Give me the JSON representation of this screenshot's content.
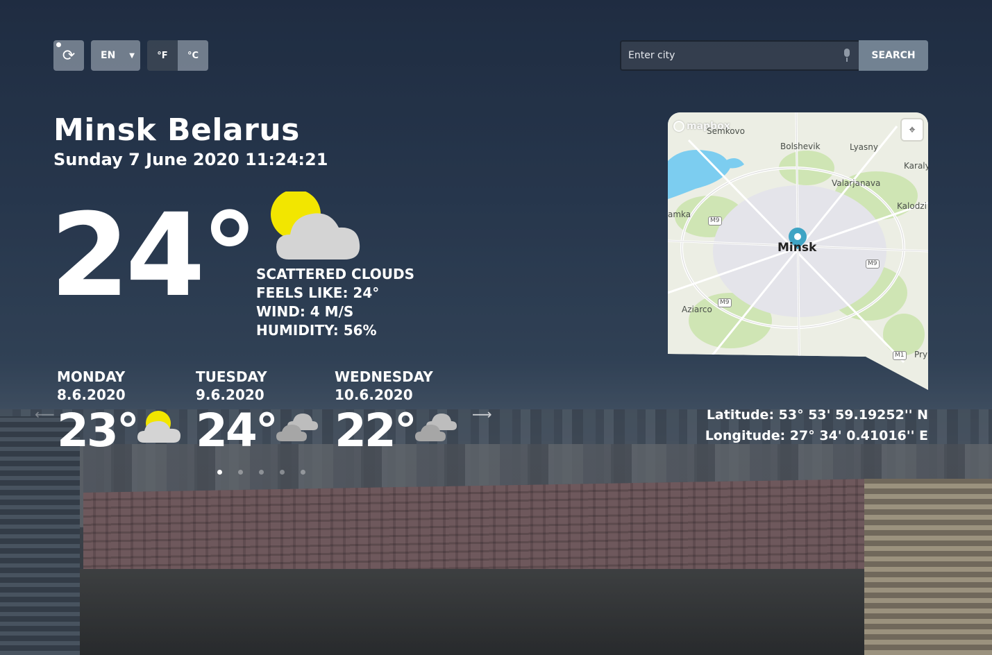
{
  "controls": {
    "refresh_icon": "refresh-icon",
    "language": "EN",
    "unit_f": "°F",
    "unit_c": "°C"
  },
  "search": {
    "placeholder": "Enter city",
    "button_label": "SEARCH",
    "mic_icon": "microphone-icon"
  },
  "location": {
    "city": "Minsk Belarus",
    "datetime": "Sunday 7 June 2020 11:24:21"
  },
  "current": {
    "temperature": "24°",
    "icon": "sun-behind-cloud-icon",
    "description": "SCATTERED CLOUDS",
    "feels_like": "FEELS LIKE: 24°",
    "wind": "WIND: 4 m/s",
    "humidity": "HUMIDITY: 56%"
  },
  "forecast": [
    {
      "day": "MONDAY",
      "date": "8.6.2020",
      "temp": "23°",
      "icon": "sun-behind-cloud-icon"
    },
    {
      "day": "TUESDAY",
      "date": "9.6.2020",
      "temp": "24°",
      "icon": "clouds-icon"
    },
    {
      "day": "WEDNESDAY",
      "date": "10.6.2020",
      "temp": "22°",
      "icon": "clouds-icon"
    }
  ],
  "carousel": {
    "pages": 5,
    "active": 0
  },
  "map": {
    "logo": "mapbox",
    "labels": {
      "semkovo": "Semkovo",
      "bolshevik": "Bolshevik",
      "lyasny": "Lyasny",
      "karaly": "Karaly",
      "valarjanava": "Valarjanava",
      "kalodzi": "Kalodzi",
      "amka": "amka",
      "minsk": "Minsk",
      "aziarco": "Aziarco",
      "pry": "Pry"
    },
    "roads": {
      "m9_a": "M9",
      "m9_b": "M9",
      "m9_c": "M9",
      "m1": "M1"
    }
  },
  "coordinates": {
    "latitude": "Latitude: 53° 53' 59.19252'' N",
    "longitude": "Longitude: 27° 34' 0.41016'' E"
  },
  "colors": {
    "accent_panel": "#96a5b4",
    "map_pin": "#3fa4c4",
    "water": "#7ccdf0"
  }
}
